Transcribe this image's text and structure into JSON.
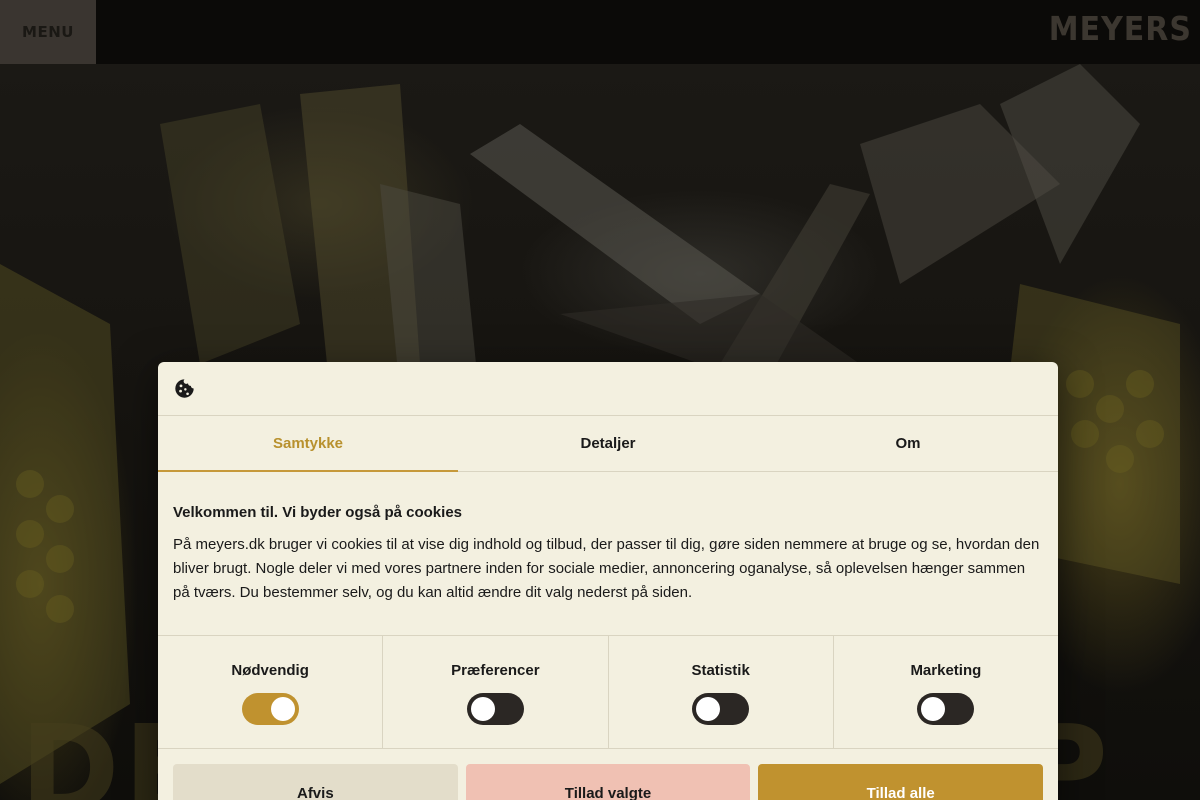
{
  "topbar": {
    "menu_label": "MENU",
    "logo_text": "MEYERS"
  },
  "hero": {
    "word_left": "DE",
    "word_right": "P"
  },
  "dialog": {
    "tabs": [
      {
        "label": "Samtykke",
        "active": true
      },
      {
        "label": "Detaljer",
        "active": false
      },
      {
        "label": "Om",
        "active": false
      }
    ],
    "heading": "Velkommen til. Vi byder også på cookies",
    "body": "På meyers.dk bruger vi cookies til at vise dig indhold og tilbud, der passer til dig, gøre siden nemmere at bruge og se, hvordan den bliver brugt. Nogle deler vi med vores partnere inden for sociale medier, annoncering oganalyse, så oplevelsen hænger sammen på tværs. Du bestemmer selv, og du kan altid ændre dit valg nederst på siden.",
    "toggles": [
      {
        "label": "Nødvendig",
        "on": true
      },
      {
        "label": "Præferencer",
        "on": false
      },
      {
        "label": "Statistik",
        "on": false
      },
      {
        "label": "Marketing",
        "on": false
      }
    ],
    "buttons": {
      "reject": "Afvis",
      "allow_selected": "Tillad valgte",
      "allow_all": "Tillad alle"
    }
  },
  "colors": {
    "accent": "#c0922f",
    "dialog_bg": "#f3f0e0",
    "allow_selected_bg": "#f0c1b3",
    "reject_bg": "#e3ddca",
    "toggle_off": "#2b2724"
  }
}
